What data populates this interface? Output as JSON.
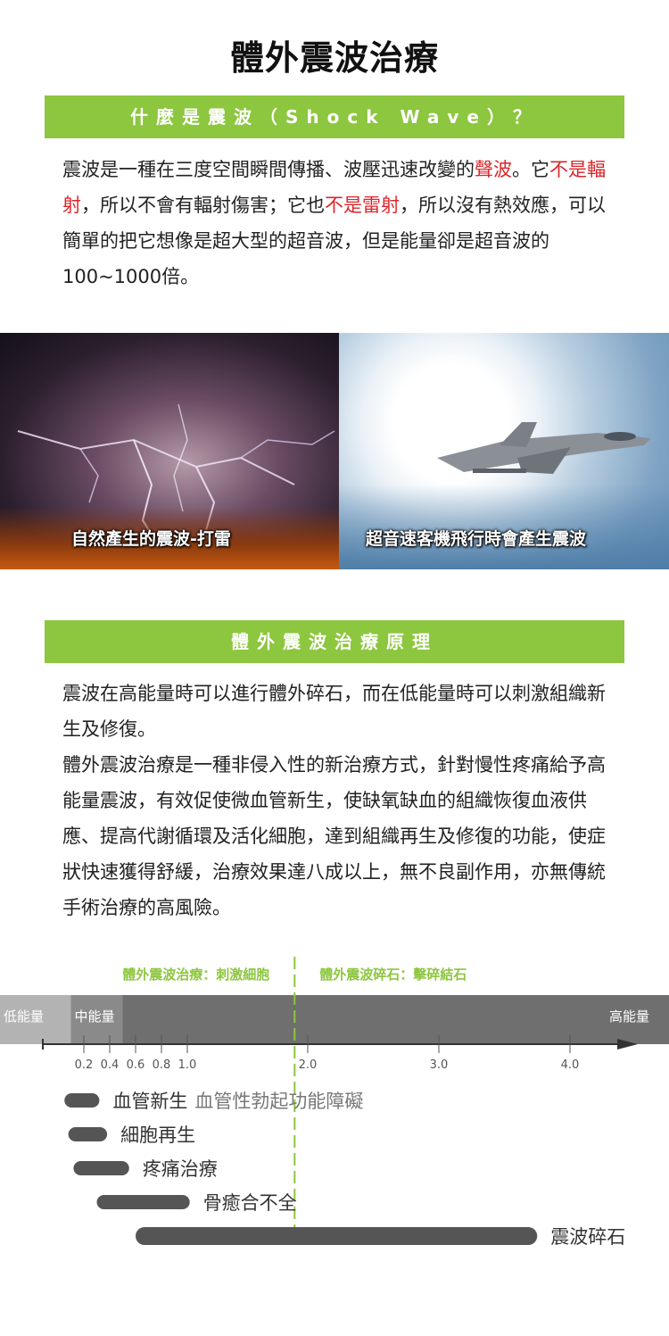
{
  "page_title": "體外震波治療",
  "section1": {
    "heading": "什麼是震波（Shock Wave）？",
    "para": {
      "t1": "震波是一種在三度空間瞬間傳播、波壓迅速改變的",
      "r1": "聲波",
      "t2": "。它",
      "r2": "不是輻射",
      "t3": "，所以不會有輻射傷害；它也",
      "r3": "不是雷射",
      "t4": "，所以沒有熱效應，可以簡單的把它想像是超大型的超音波，但是能量卻是超音波的100~1000倍。"
    }
  },
  "photos": {
    "left_caption": "自然產生的震波-打雷",
    "right_caption": "超音速客機飛行時會產生震波"
  },
  "section2": {
    "heading": "體外震波治療原理",
    "para1": "震波在高能量時可以進行體外碎石，而在低能量時可以刺激組織新生及修復。",
    "para2": "體外震波治療是一種非侵入性的新治療方式，針對慢性疼痛給予高能量震波，有效促使微血管新生，使缺氧缺血的組織恢復血液供應、提高代謝循環及活化細胞，達到組織再生及修復的功能，使症狀快速獲得舒緩，治療效果達八成以上，無不良副作用，亦無傳統手術治療的高風險。"
  },
  "colors": {
    "accent_green": "#8dc63f",
    "highlight_red": "#d9262b",
    "band_light": "#b3b3b3",
    "band_mid": "#8a8a8a",
    "band_dark": "#6f6f6f",
    "bar": "#555555"
  },
  "chart_data": {
    "type": "range",
    "top_labels": {
      "left": "體外震波治療：刺激細胞",
      "right": "體外震波碎石：擊碎結石"
    },
    "divider_value": 1.9,
    "bands": [
      {
        "label": "低能量",
        "from": -0.1,
        "to": 0.1
      },
      {
        "label": "中能量",
        "from": 0.1,
        "to": 0.5
      },
      {
        "label": "高能量",
        "from": 0.5,
        "to": 4.35
      }
    ],
    "ticks": [
      {
        "value": 0.2,
        "label": "0.2"
      },
      {
        "value": 0.4,
        "label": "0.4"
      },
      {
        "value": 0.6,
        "label": "0.6"
      },
      {
        "value": 0.8,
        "label": "0.8"
      },
      {
        "value": 1.0,
        "label": "1.0"
      },
      {
        "value": 2.0,
        "label": "2.0"
      },
      {
        "value": 3.0,
        "label": "3.0"
      },
      {
        "value": 4.0,
        "label": "4.0"
      }
    ],
    "xlim": [
      -0.1,
      4.4
    ],
    "ranges": [
      {
        "from": 0.05,
        "to": 0.32,
        "label": "血管新生",
        "note": "血管性勃起功能障礙"
      },
      {
        "from": 0.08,
        "to": 0.38,
        "label": "細胞再生"
      },
      {
        "from": 0.12,
        "to": 0.55,
        "label": "疼痛治療"
      },
      {
        "from": 0.3,
        "to": 1.1,
        "label": "骨癒合不全"
      },
      {
        "from": 0.6,
        "to": 3.75,
        "label": "震波碎石"
      }
    ]
  }
}
